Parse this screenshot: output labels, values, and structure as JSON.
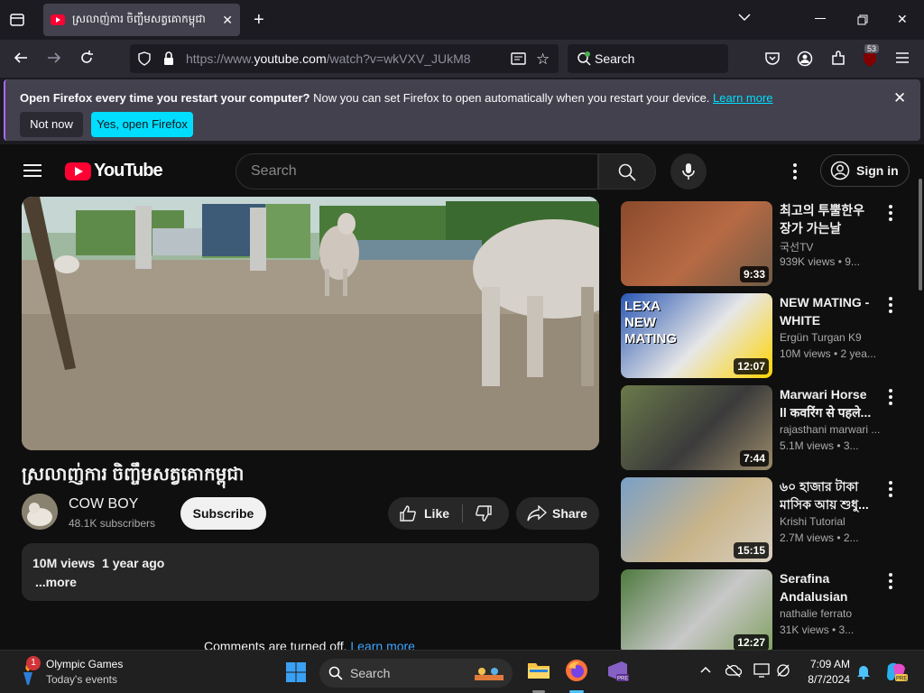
{
  "browser": {
    "tab_title": "ស្រលាញ់ការ ចិញ្ចឹមសត្វគោកម្ពុជា",
    "url_prefix": "https://www.",
    "url_host": "youtube.com",
    "url_path": "/watch?v=wkVXV_JUkM8",
    "search_placeholder": "Search",
    "extensions_badge": "53"
  },
  "notification": {
    "bold": "Open Firefox every time you restart your computer?",
    "text": " Now you can set Firefox to open automatically when you restart your device. ",
    "link": "Learn more",
    "not_now": "Not now",
    "yes": "Yes, open Firefox"
  },
  "youtube": {
    "logo_text": "YouTube",
    "search_placeholder": "Search",
    "sign_in": "Sign in"
  },
  "video": {
    "title": "ស្រលាញ់ការ ចិញ្ចឹមសត្វគោកម្ពុជា",
    "channel": "COW BOY",
    "subscribers": "48.1K subscribers",
    "subscribe": "Subscribe",
    "like": "Like",
    "share": "Share",
    "views": "10M views",
    "age": "1 year ago",
    "more": "...more",
    "comments_off": "Comments are turned off.",
    "comments_link": "Learn more"
  },
  "recommendations": [
    {
      "title": "최고의 투뿔한우 장가 가는날",
      "channel": "국선TV",
      "meta": "939K views • 9...",
      "duration": "9:33",
      "colors": [
        "#8b4a2c",
        "#b76a44",
        "#6e5a46"
      ]
    },
    {
      "title": "NEW MATING - WHITE GERMA...",
      "channel": "Ergün Turgan K9",
      "meta": "10M views • 2 yea...",
      "duration": "12:07",
      "colors": [
        "#2a57b3",
        "#e7e7e7",
        "#ffd400"
      ],
      "thumb_text": "LEXA NEW MATING"
    },
    {
      "title": "Marwari Horse ll कवरिंग से पहले...",
      "channel": "rajasthani marwari ...",
      "meta": "5.1M views • 3...",
      "duration": "7:44",
      "colors": [
        "#6b7a4a",
        "#3b3b3b",
        "#9a8a6a"
      ]
    },
    {
      "title": "৬০ হাজার টাকা মাসিক আয় শুধু...",
      "channel": "Krishi Tutorial",
      "meta": "2.7M views • 2...",
      "duration": "15:15",
      "colors": [
        "#7aa0c8",
        "#c9b48a",
        "#d8d0c0"
      ]
    },
    {
      "title": "Serafina Andalusian filly...",
      "channel": "nathalie ferrato",
      "meta": "31K views • 3...",
      "duration": "12:27",
      "colors": [
        "#4f7a3f",
        "#c8c8c8",
        "#80a060"
      ]
    }
  ],
  "taskbar": {
    "widget_title": "Olympic Games",
    "widget_sub": "Today's events",
    "widget_badge": "1",
    "search": "Search",
    "time": "7:09 AM",
    "date": "8/7/2024"
  }
}
